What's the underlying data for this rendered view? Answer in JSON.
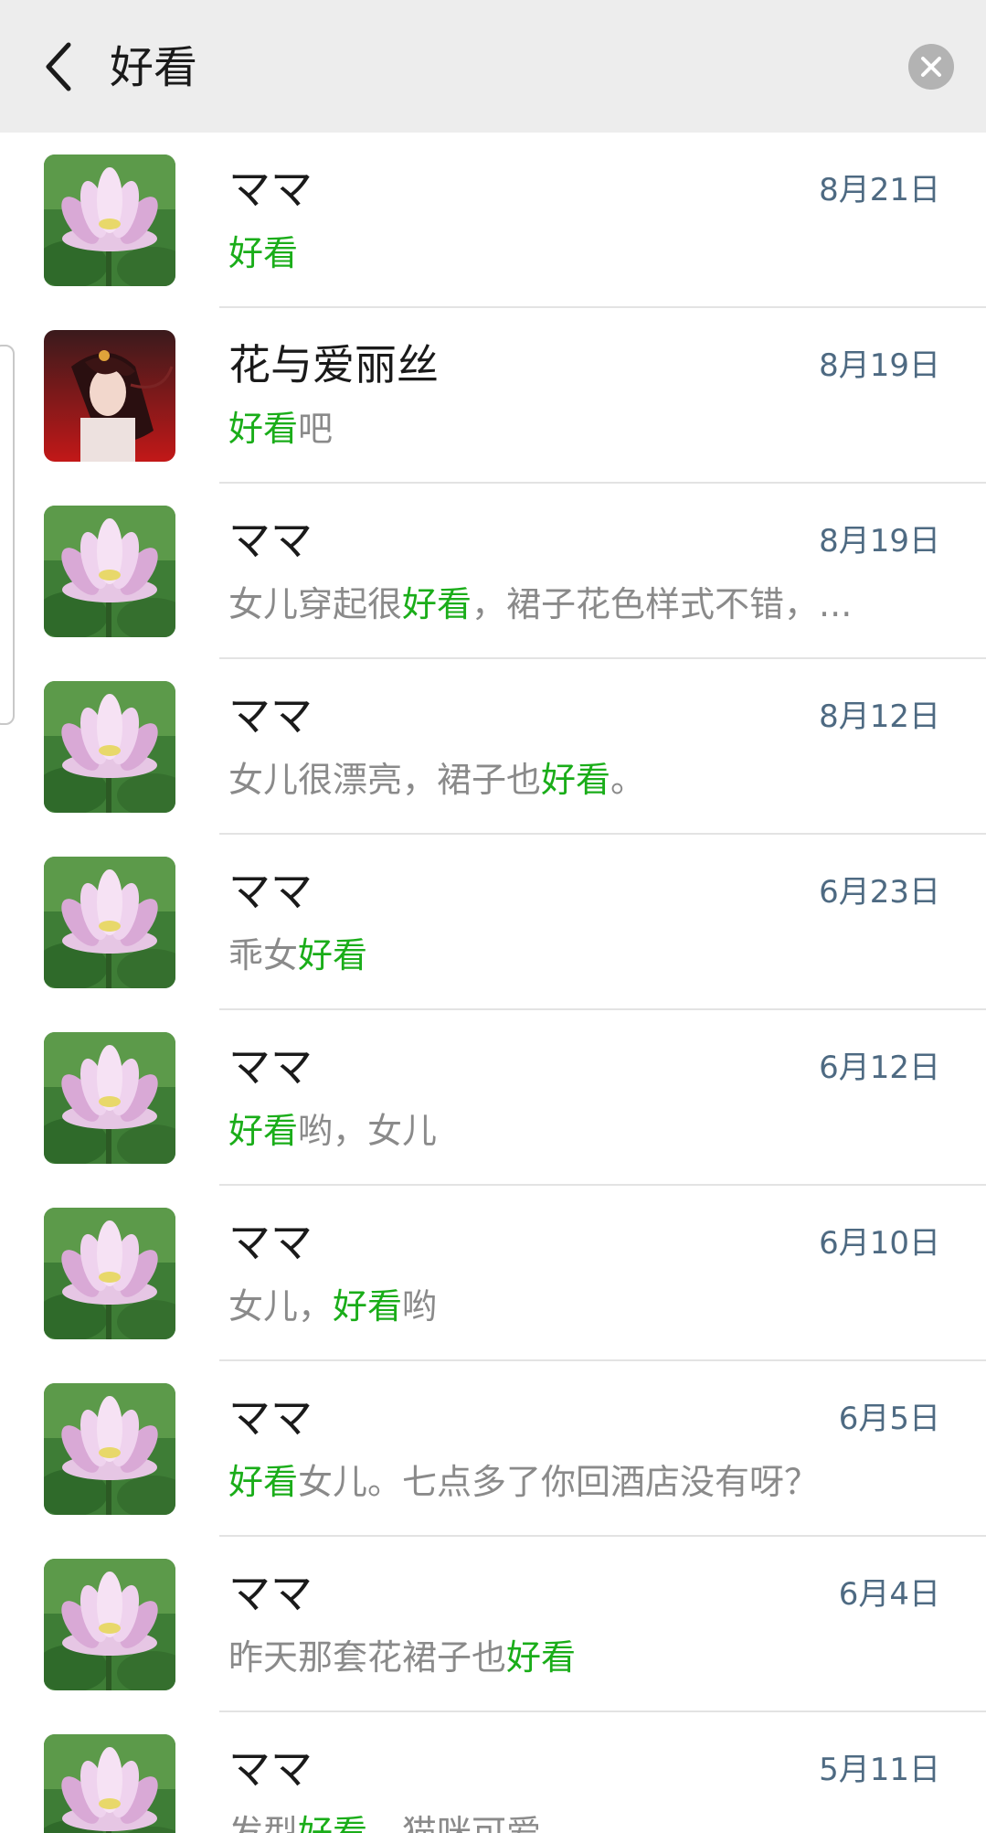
{
  "search": {
    "query": "好看"
  },
  "colors": {
    "highlight": "#1aad19",
    "snippet": "#8a8a8a",
    "date": "#4e6a82",
    "header_bg": "#ededed"
  },
  "icons": {
    "back": "chevron-left-icon",
    "clear": "close-circle-icon"
  },
  "results": [
    {
      "name": "ママ",
      "date": "8月21日",
      "avatar": "lotus",
      "snippet": [
        {
          "text": "好看",
          "hl": true
        }
      ]
    },
    {
      "name": "花与爱丽丝",
      "date": "8月19日",
      "avatar": "anime-girl",
      "snippet": [
        {
          "text": "好看",
          "hl": true
        },
        {
          "text": "吧",
          "hl": false
        }
      ]
    },
    {
      "name": "ママ",
      "date": "8月19日",
      "avatar": "lotus",
      "snippet": [
        {
          "text": "女儿穿起很",
          "hl": false
        },
        {
          "text": "好看",
          "hl": true
        },
        {
          "text": "，裙子花色样式不错，...",
          "hl": false
        }
      ]
    },
    {
      "name": "ママ",
      "date": "8月12日",
      "avatar": "lotus",
      "snippet": [
        {
          "text": "女儿很漂亮，裙子也",
          "hl": false
        },
        {
          "text": "好看",
          "hl": true
        },
        {
          "text": "。",
          "hl": false
        }
      ]
    },
    {
      "name": "ママ",
      "date": "6月23日",
      "avatar": "lotus",
      "snippet": [
        {
          "text": "乖女",
          "hl": false
        },
        {
          "text": "好看",
          "hl": true
        }
      ]
    },
    {
      "name": "ママ",
      "date": "6月12日",
      "avatar": "lotus",
      "snippet": [
        {
          "text": "好看",
          "hl": true
        },
        {
          "text": "哟，女儿",
          "hl": false
        }
      ]
    },
    {
      "name": "ママ",
      "date": "6月10日",
      "avatar": "lotus",
      "snippet": [
        {
          "text": "女儿，",
          "hl": false
        },
        {
          "text": "好看",
          "hl": true
        },
        {
          "text": "哟",
          "hl": false
        }
      ]
    },
    {
      "name": "ママ",
      "date": "6月5日",
      "avatar": "lotus",
      "snippet": [
        {
          "text": "好看",
          "hl": true
        },
        {
          "text": "女儿。七点多了你回酒店没有呀？",
          "hl": false
        }
      ]
    },
    {
      "name": "ママ",
      "date": "6月4日",
      "avatar": "lotus",
      "snippet": [
        {
          "text": "昨天那套花裙子也",
          "hl": false
        },
        {
          "text": "好看",
          "hl": true
        }
      ]
    },
    {
      "name": "ママ",
      "date": "5月11日",
      "avatar": "lotus",
      "snippet": [
        {
          "text": "发型",
          "hl": false
        },
        {
          "text": "好看",
          "hl": true
        },
        {
          "text": "，猫咪可爱",
          "hl": false
        }
      ]
    }
  ]
}
